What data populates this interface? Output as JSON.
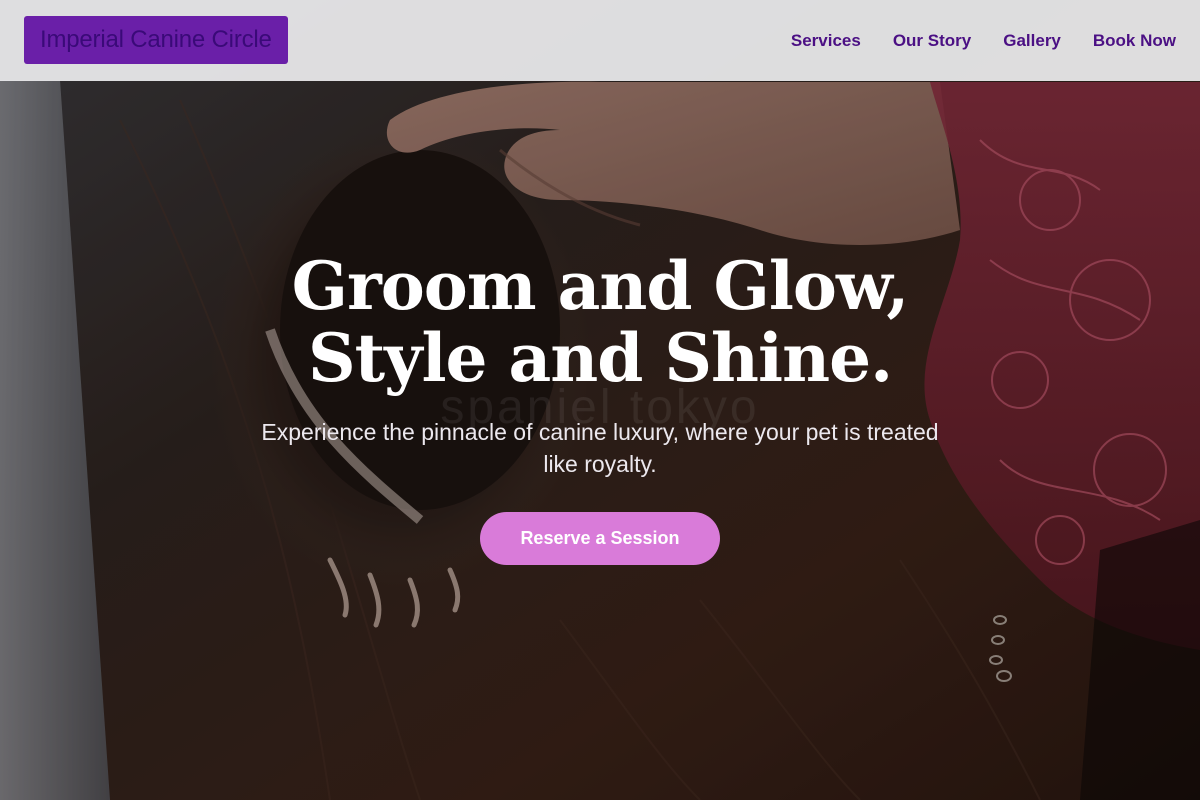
{
  "header": {
    "brand": "Imperial Canine Circle",
    "nav": [
      {
        "label": "Services"
      },
      {
        "label": "Our Story"
      },
      {
        "label": "Gallery"
      },
      {
        "label": "Book Now"
      }
    ]
  },
  "hero": {
    "title_line1": "Groom and Glow,",
    "title_line2": "Style and Shine.",
    "subtitle": "Experience the pinnacle of canine luxury, where your pet is treated like royalty.",
    "cta_label": "Reserve a Session",
    "photo_watermark": "spaniel tokyo"
  },
  "colors": {
    "brand_bg": "#6a1fa8",
    "nav_text": "#4b1084",
    "cta_bg": "#d97bd9"
  }
}
